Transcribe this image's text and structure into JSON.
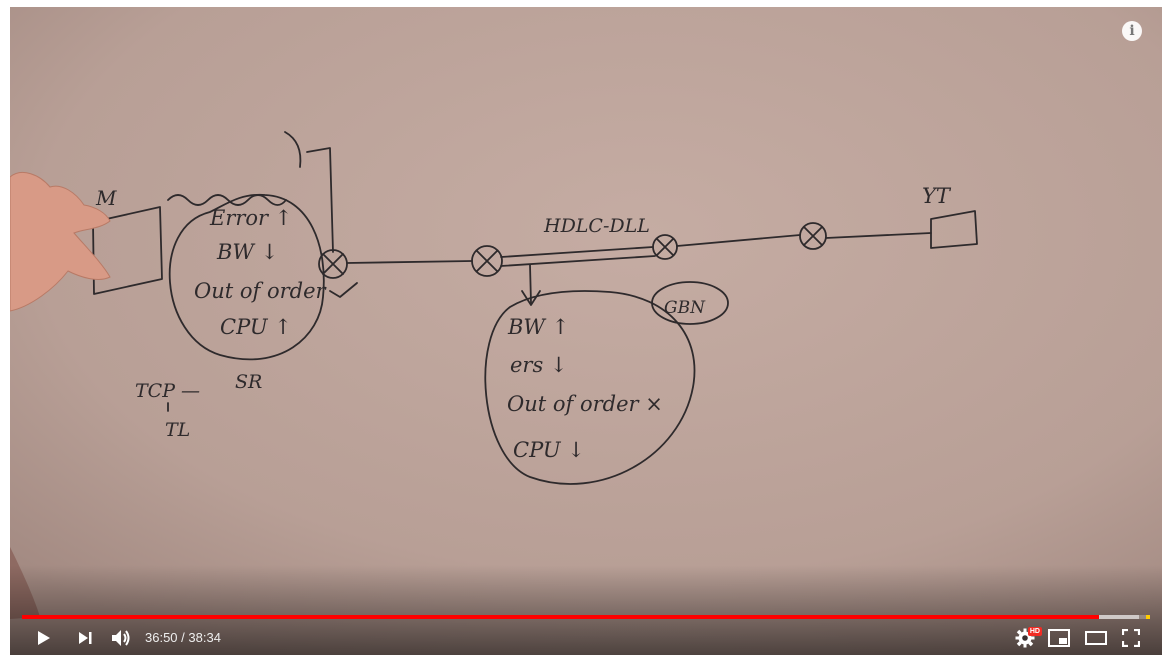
{
  "player": {
    "current_time": "36:50",
    "duration": "38:34",
    "time_separator": " / ",
    "progress_fraction": 0.955,
    "buffer_fraction": 0.99,
    "accent_color": "#ff0000",
    "ad_marker_color": "#ffcc00",
    "quality_badge": "HD",
    "info_label": "i",
    "controls": [
      "play-icon",
      "next-icon",
      "volume-icon",
      "settings-icon",
      "miniplayer-icon",
      "theater-icon",
      "fullscreen-icon"
    ]
  },
  "board": {
    "left_box_label": "M",
    "left_bubble_lines": [
      "Error ↑",
      "BW ↓",
      "Out of order",
      "CPU ↑"
    ],
    "bottom_left_1": "TCP —",
    "bottom_left_sr": "SR",
    "bottom_left_2": "TL",
    "line_label": "HDLC-DLL",
    "right_box_label": "YT",
    "gbn_label": "GBN",
    "right_bubble_lines": [
      "BW ↑",
      "ers ↓",
      "Out of order ×",
      "CPU ↓"
    ]
  }
}
